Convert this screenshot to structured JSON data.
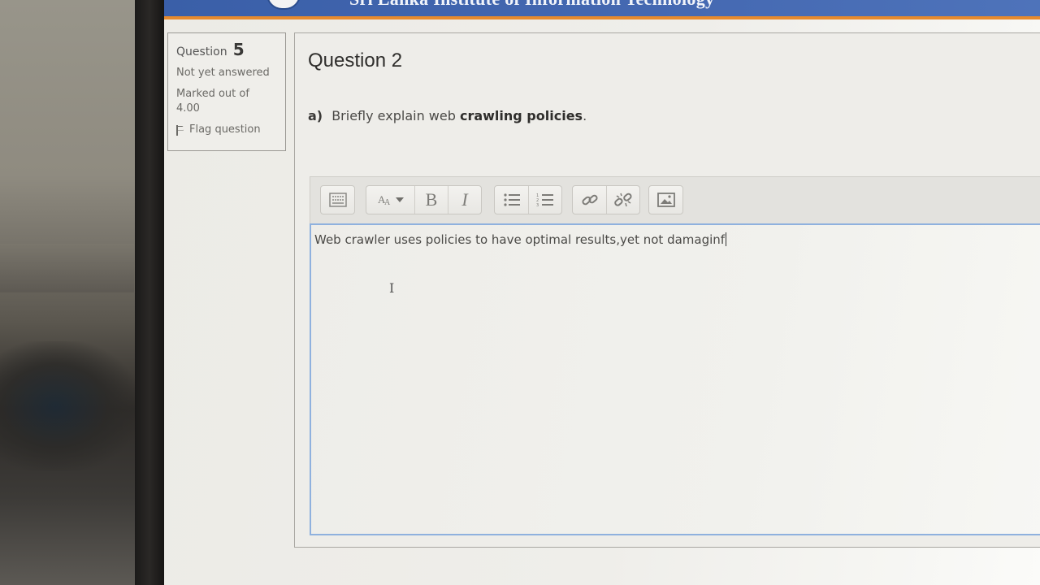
{
  "banner": {
    "title": "Sri Lanka Institute of Information Technology",
    "colors": {
      "bar": "#4569b2",
      "stripe": "#e68a2e"
    }
  },
  "info": {
    "question_label": "Question",
    "question_number": "5",
    "status": "Not yet answered",
    "marked_out_of": "Marked out of 4.00",
    "flag_label": "Flag question"
  },
  "question": {
    "title": "Question 2",
    "prefix": "a)",
    "text_plain": "Briefly explain web",
    "text_bold": "crawling policies",
    "text_end": "."
  },
  "toolbar": {
    "buttons": [
      {
        "name": "toolbar-toggle-button",
        "icon": "toolbar-toggle-icon"
      },
      {
        "name": "font-size-button",
        "icon": "font-size-icon"
      },
      {
        "name": "bold-button",
        "label": "B"
      },
      {
        "name": "italic-button",
        "label": "I"
      },
      {
        "name": "unordered-list-button",
        "icon": "bullet-list-icon"
      },
      {
        "name": "ordered-list-button",
        "icon": "numbered-list-icon"
      },
      {
        "name": "link-button",
        "icon": "link-icon"
      },
      {
        "name": "unlink-button",
        "icon": "unlink-icon"
      },
      {
        "name": "image-button",
        "icon": "image-icon"
      }
    ]
  },
  "editor": {
    "content": "Web crawler uses policies to have optimal results,yet not damaginf",
    "border_color": "#8fb1de"
  }
}
